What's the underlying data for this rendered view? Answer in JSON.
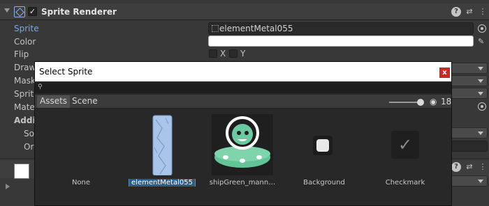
{
  "component": {
    "title": "Sprite Renderer",
    "enabled": true,
    "help_icon": "help-icon",
    "preset_icon": "preset-icon",
    "more_icon": "more-vert-icon"
  },
  "properties": {
    "sprite_label": "Sprite",
    "sprite_value": "elementMetal055",
    "color_label": "Color",
    "color_value": "#FFFFFF",
    "flip_label": "Flip",
    "flip_x": "X",
    "flip_y": "Y",
    "draw_label": "Draw",
    "mask_label": "Mask",
    "sprite2_label": "Sprite",
    "mate_label": "Mate",
    "addi_label": "Addi",
    "so_label": "So",
    "or_label": "Ord"
  },
  "select_window": {
    "title": "Select Sprite",
    "close_label": "x",
    "search_icon": "search-icon",
    "search_value": "",
    "tabs": [
      {
        "label": "Assets",
        "active": true
      },
      {
        "label": "Scene",
        "active": false
      }
    ],
    "visibility_icon": "eye-slash-icon",
    "hidden_count": "18",
    "items": [
      {
        "label": "None",
        "selected": false
      },
      {
        "label": "elementMetal055",
        "selected": true
      },
      {
        "label": "shipGreen_mann…",
        "selected": false
      },
      {
        "label": "Background",
        "selected": false
      },
      {
        "label": "Checkmark",
        "selected": false
      }
    ]
  },
  "colors": {
    "sprite_label_accent": "#7BA6E6",
    "selection": "#2C5D87",
    "close_button": "#C42B2B",
    "ship_green": "#63C497"
  }
}
